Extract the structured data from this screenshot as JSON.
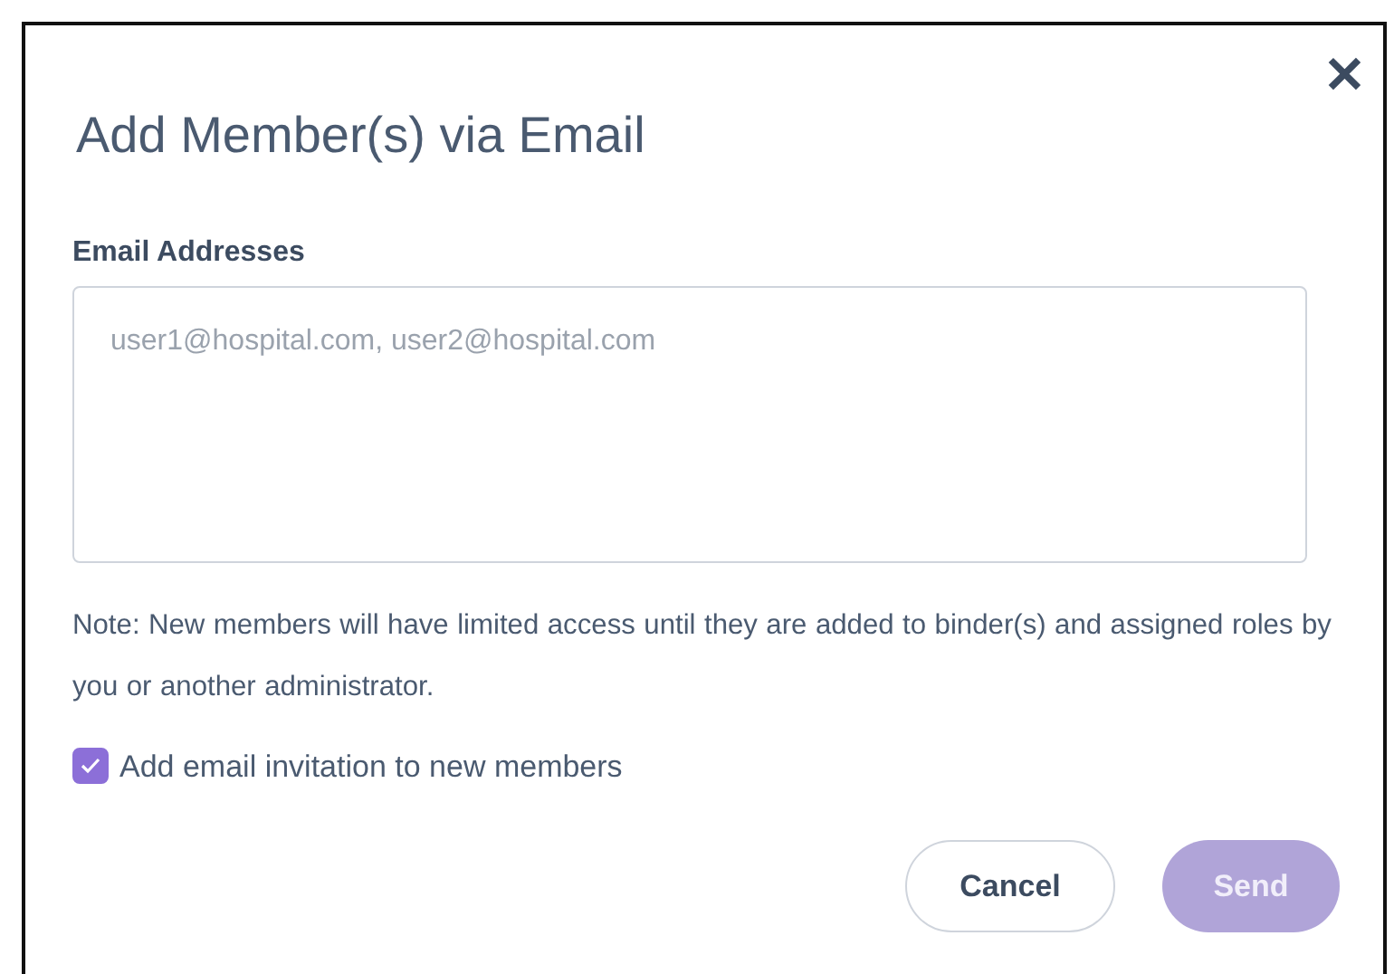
{
  "dialog": {
    "title": "Add Member(s) via Email",
    "close": "✕",
    "email_field": {
      "label": "Email Addresses",
      "placeholder": "user1@hospital.com, user2@hospital.com"
    },
    "note": "Note: New members will have limited access until they are added to binder(s) and assigned roles by you or another administrator.",
    "invite_checkbox": {
      "label": "Add email invitation to new members",
      "checked": true
    },
    "buttons": [
      {
        "label": "Cancel",
        "kind": "secondary",
        "disabled": false
      },
      {
        "label": "Send",
        "kind": "primary",
        "disabled": true
      }
    ]
  }
}
